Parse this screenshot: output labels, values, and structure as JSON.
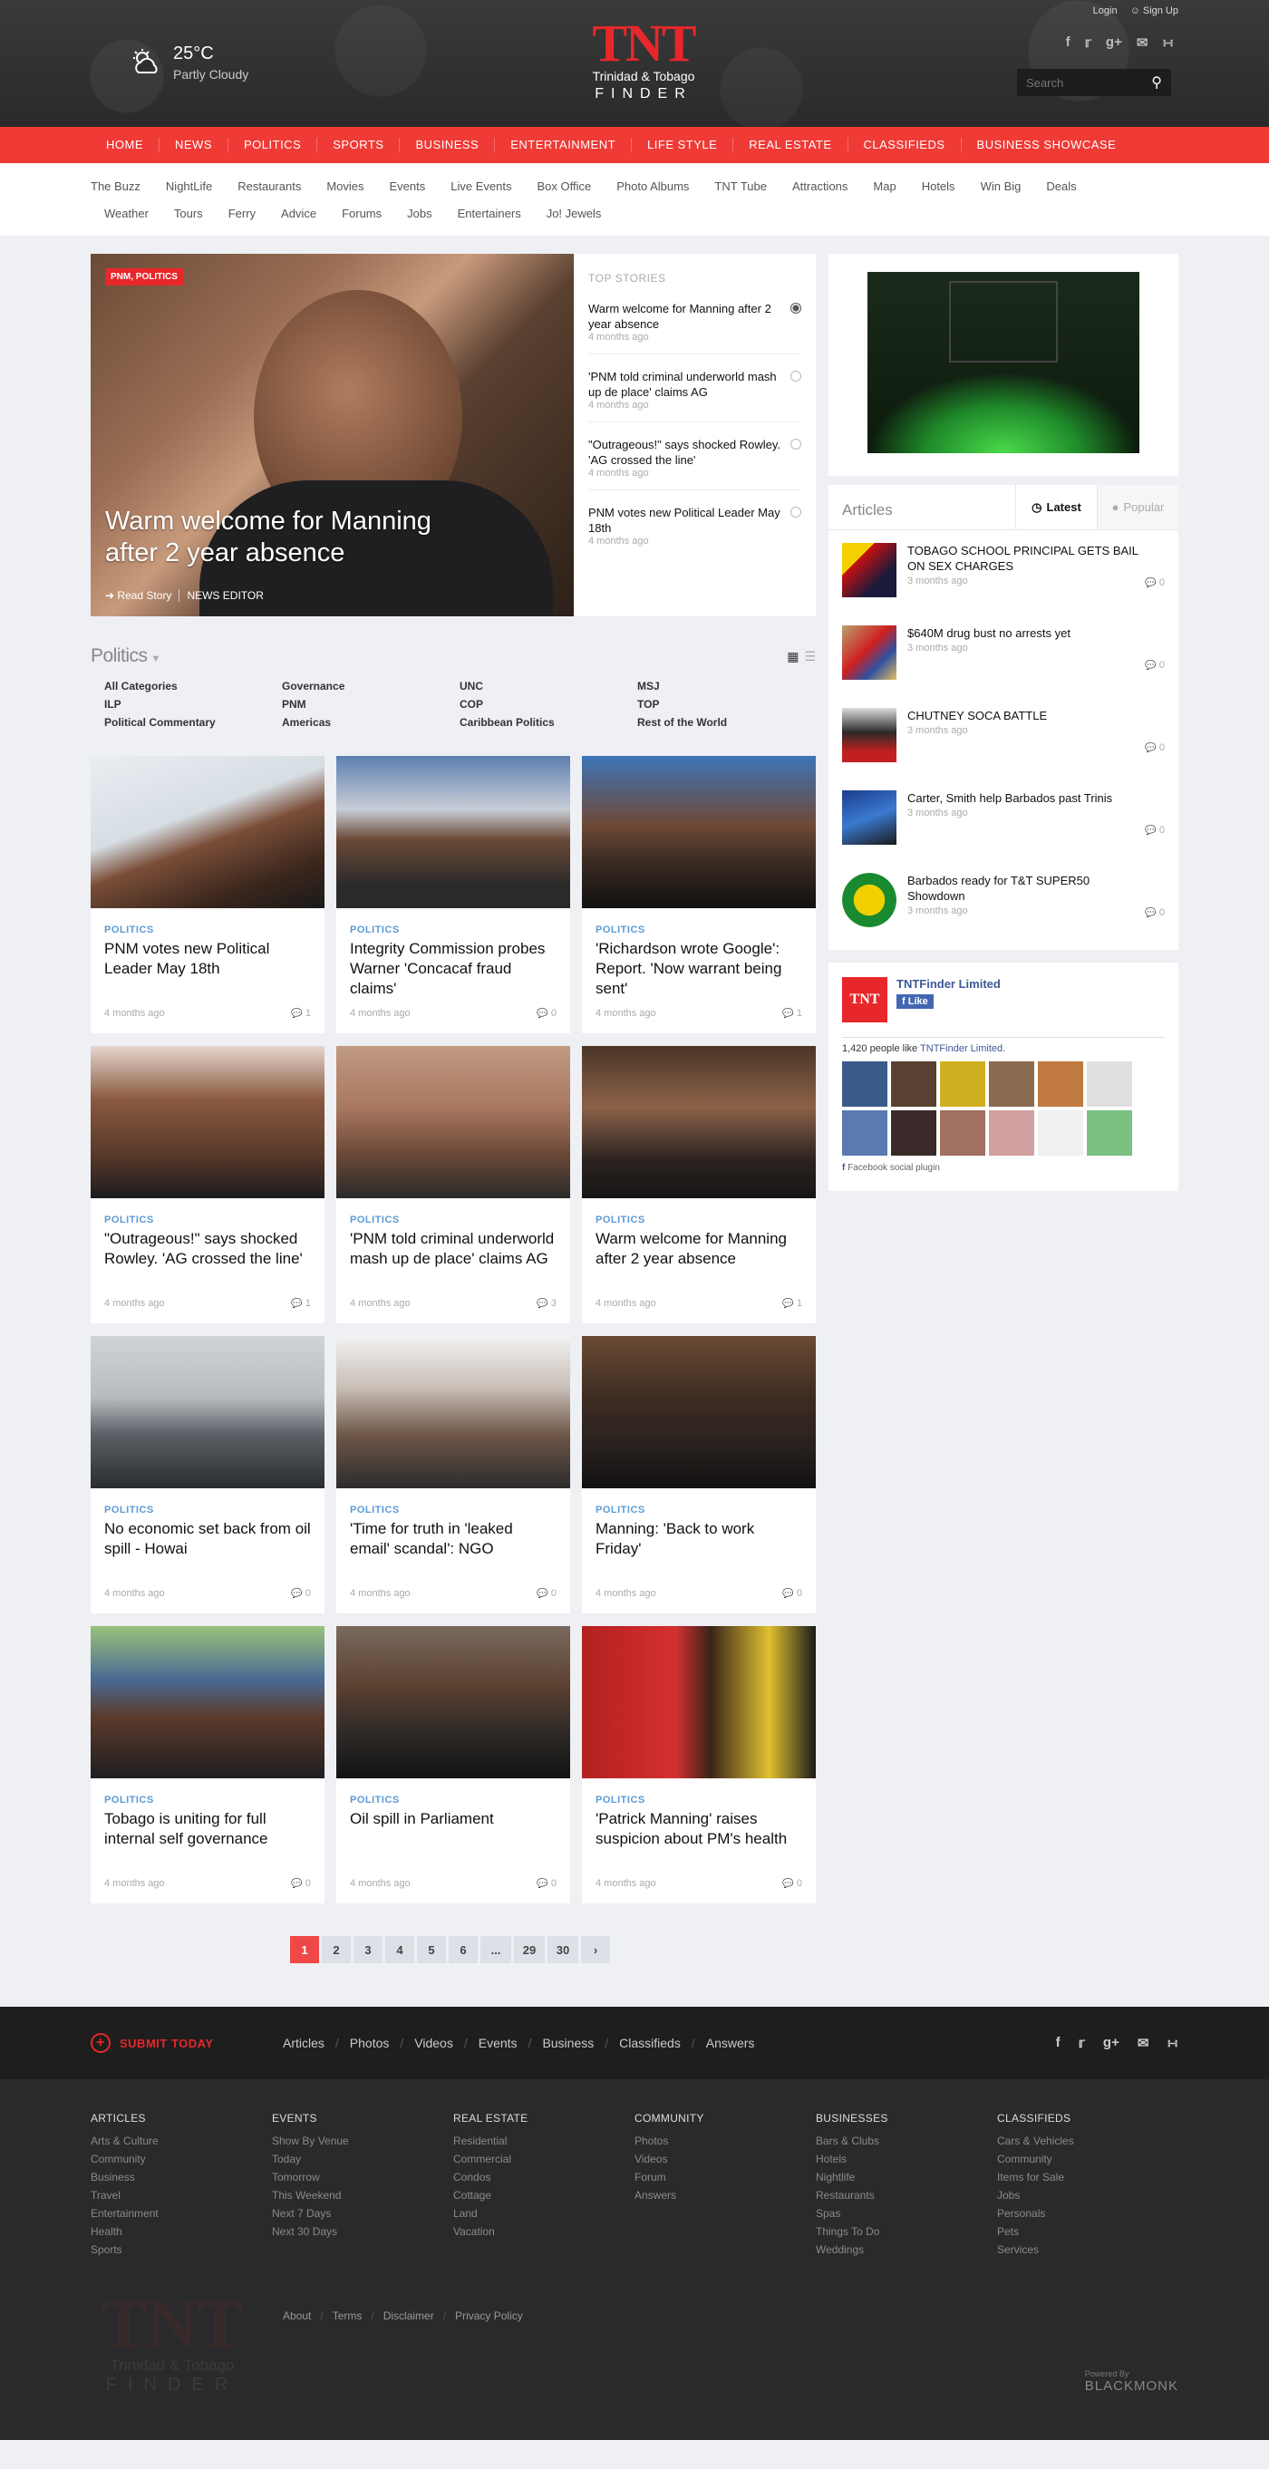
{
  "header": {
    "weather": {
      "temp": "25°C",
      "condition": "Partly Cloudy"
    },
    "logo": {
      "main": "TNT",
      "sub": "Trinidad & Tobago",
      "finder": "FINDER"
    },
    "auth": {
      "login": "Login",
      "signup": "Sign Up"
    },
    "search_placeholder": "Search"
  },
  "main_nav": [
    "HOME",
    "NEWS",
    "POLITICS",
    "SPORTS",
    "BUSINESS",
    "ENTERTAINMENT",
    "LIFE STYLE",
    "REAL ESTATE",
    "CLASSIFIEDS",
    "BUSINESS SHOWCASE"
  ],
  "sub_nav_row1": [
    "The Buzz",
    "NightLife",
    "Restaurants",
    "Movies",
    "Events",
    "Live Events",
    "Box Office",
    "Photo Albums",
    "TNT Tube",
    "Attractions",
    "Map",
    "Hotels",
    "Win Big",
    "Deals"
  ],
  "sub_nav_row2": [
    "Weather",
    "Tours",
    "Ferry",
    "Advice",
    "Forums",
    "Jobs",
    "Entertainers",
    "Jo! Jewels"
  ],
  "hero": {
    "tag": "PNM, POLITICS",
    "title": "Warm welcome for Manning after 2 year absence",
    "read": "Read Story",
    "author": "NEWS EDITOR"
  },
  "top_stories": {
    "heading": "TOP STORIES",
    "items": [
      {
        "title": "Warm welcome for Manning after 2 year absence",
        "date": "4 months ago"
      },
      {
        "title": "'PNM told criminal underworld mash up de place' claims AG",
        "date": "4 months ago"
      },
      {
        "title": "\"Outrageous!\" says shocked Rowley. 'AG crossed the line'",
        "date": "4 months ago"
      },
      {
        "title": "PNM votes new Political Leader May 18th",
        "date": "4 months ago"
      }
    ]
  },
  "politics": {
    "title": "Politics",
    "categories": [
      "All Categories",
      "Governance",
      "UNC",
      "MSJ",
      "ILP",
      "PNM",
      "COP",
      "TOP",
      "Political Commentary",
      "Americas",
      "Caribbean Politics",
      "Rest of the World"
    ]
  },
  "cards": [
    {
      "cat": "POLITICS",
      "title": "PNM votes new Political Leader May 18th",
      "date": "4 months ago",
      "comments": "1"
    },
    {
      "cat": "POLITICS",
      "title": "Integrity Commission probes Warner 'Concacaf fraud claims'",
      "date": "4 months ago",
      "comments": "0"
    },
    {
      "cat": "POLITICS",
      "title": "'Richardson wrote Google': Report. 'Now warrant being sent'",
      "date": "4 months ago",
      "comments": "1"
    },
    {
      "cat": "POLITICS",
      "title": "\"Outrageous!\" says shocked Rowley. 'AG crossed the line'",
      "date": "4 months ago",
      "comments": "1"
    },
    {
      "cat": "POLITICS",
      "title": "'PNM told criminal underworld mash up de place' claims AG",
      "date": "4 months ago",
      "comments": "3"
    },
    {
      "cat": "POLITICS",
      "title": "Warm welcome for Manning after 2 year absence",
      "date": "4 months ago",
      "comments": "1"
    },
    {
      "cat": "POLITICS",
      "title": "No economic set back from oil spill - Howai",
      "date": "4 months ago",
      "comments": "0"
    },
    {
      "cat": "POLITICS",
      "title": "'Time for truth in 'leaked email' scandal': NGO",
      "date": "4 months ago",
      "comments": "0"
    },
    {
      "cat": "POLITICS",
      "title": "Manning: 'Back to work Friday'",
      "date": "4 months ago",
      "comments": "0"
    },
    {
      "cat": "POLITICS",
      "title": "Tobago is uniting for full internal self governance",
      "date": "4 months ago",
      "comments": "0"
    },
    {
      "cat": "POLITICS",
      "title": "Oil spill in Parliament",
      "date": "4 months ago",
      "comments": "0"
    },
    {
      "cat": "POLITICS",
      "title": "'Patrick Manning' raises suspicion about PM's health",
      "date": "4 months ago",
      "comments": "0"
    }
  ],
  "pager": [
    "1",
    "2",
    "3",
    "4",
    "5",
    "6",
    "...",
    "29",
    "30",
    "›"
  ],
  "articles": {
    "label": "Articles",
    "tab_latest": "Latest",
    "tab_popular": "Popular",
    "items": [
      {
        "title": "TOBAGO SCHOOL PRINCIPAL GETS BAIL ON SEX CHARGES",
        "date": "3 months ago",
        "comments": "0"
      },
      {
        "title": "$640M drug bust no arrests yet",
        "date": "3 months ago",
        "comments": "0"
      },
      {
        "title": "CHUTNEY SOCA BATTLE",
        "date": "3 months ago",
        "comments": "0"
      },
      {
        "title": "Carter, Smith help Barbados past Trinis",
        "date": "3 months ago",
        "comments": "0"
      },
      {
        "title": "Barbados ready for T&T SUPER50 Showdown",
        "date": "3 months ago",
        "comments": "0"
      }
    ]
  },
  "facebook": {
    "name": "TNTFinder Limited",
    "like": "Like",
    "count_text": "1,420 people like",
    "count_link": "TNTFinder Limited.",
    "plugin": "Facebook social plugin"
  },
  "footer": {
    "submit": "SUBMIT TODAY",
    "links": [
      "Articles",
      "Photos",
      "Videos",
      "Events",
      "Business",
      "Classifieds",
      "Answers"
    ],
    "columns": [
      {
        "title": "ARTICLES",
        "items": [
          "Arts & Culture",
          "Community",
          "Business",
          "Travel",
          "Entertainment",
          "Health",
          "Sports"
        ]
      },
      {
        "title": "EVENTS",
        "items": [
          "Show By Venue",
          "Today",
          "Tomorrow",
          "This Weekend",
          "Next 7 Days",
          "Next 30 Days"
        ]
      },
      {
        "title": "REAL ESTATE",
        "items": [
          "Residential",
          "Commercial",
          "Condos",
          "Cottage",
          "Land",
          "Vacation"
        ]
      },
      {
        "title": "COMMUNITY",
        "items": [
          "Photos",
          "Videos",
          "Forum",
          "Answers"
        ]
      },
      {
        "title": "BUSINESSES",
        "items": [
          "Bars & Clubs",
          "Hotels",
          "Nightlife",
          "Restaurants",
          "Spas",
          "Things To Do",
          "Weddings"
        ]
      },
      {
        "title": "CLASSIFIEDS",
        "items": [
          "Cars & Vehicles",
          "Community",
          "Items for Sale",
          "Jobs",
          "Personals",
          "Pets",
          "Services"
        ]
      }
    ],
    "bottom_links": [
      "About",
      "Terms",
      "Disclaimer",
      "Privacy Policy"
    ],
    "powered": "Powered By",
    "brand": "BLACKMONK"
  },
  "colors": {
    "brand_red": "#f03a36",
    "accent_blue": "#5b9bd5",
    "fb_blue": "#3b5998"
  }
}
